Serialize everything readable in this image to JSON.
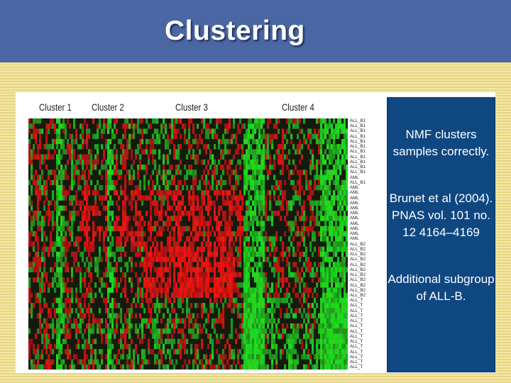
{
  "slide": {
    "title": "Clustering",
    "notes": [
      "NMF clusters samples correctly.",
      "Brunet et al (2004). PNAS vol. 101 no. 12 4164–4169",
      "Additional subgroup of ALL-B."
    ]
  },
  "figure": {
    "cluster_labels": [
      "Cluster 1",
      "Cluster 2",
      "Cluster 3",
      "Cluster 4"
    ],
    "row_labels": [
      "ALL_B1",
      "ALL_B1",
      "ALL_B1",
      "ALL_B1",
      "ALL_B1",
      "ALL_B1",
      "ALL_B1",
      "ALL_B1",
      "ALL_B1",
      "ALL_B1",
      "ALL_B1",
      "AML",
      "ALL_B1",
      "AML",
      "AML",
      "AML",
      "AML",
      "AML",
      "AML",
      "AML",
      "AML",
      "AML",
      "AML",
      "AML",
      "ALL_B2",
      "ALL_B2",
      "ALL_B2",
      "ALL_B2",
      "ALL_B2",
      "ALL_B2",
      "ALL_B2",
      "ALL_B2",
      "ALL_B2",
      "ALL_B2",
      "ALL_B2",
      "ALL_T",
      "ALL_T",
      "ALL_T",
      "ALL_T",
      "ALL_T",
      "ALL_T",
      "ALL_T",
      "ALL_T",
      "ALL_T",
      "ALL_T",
      "ALL_T",
      "ALL_T",
      "ALL_T",
      "ALL_T"
    ],
    "colors": {
      "red": "#c41616",
      "green": "#1fb81f",
      "dark": "#141a0e"
    }
  }
}
